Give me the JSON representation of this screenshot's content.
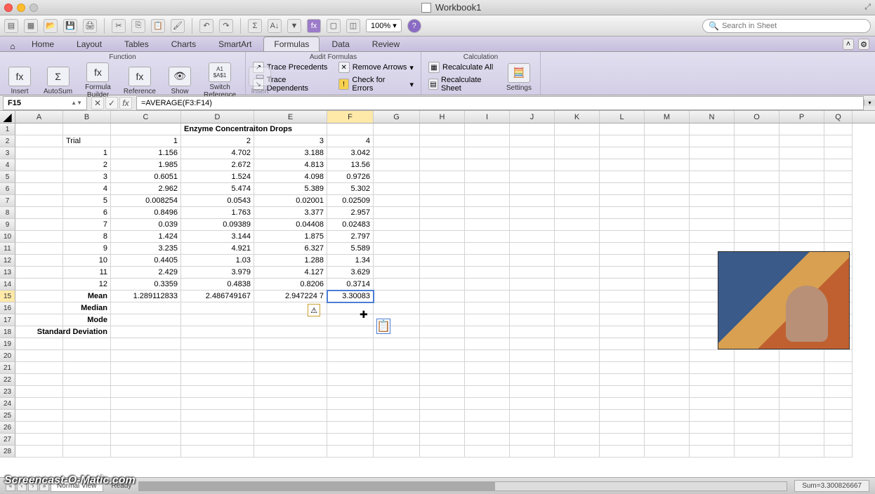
{
  "window": {
    "title": "Workbook1"
  },
  "toolbar": {
    "zoom": "100%"
  },
  "search": {
    "placeholder": "Search in Sheet"
  },
  "tabs": {
    "home": "Home",
    "layout": "Layout",
    "tables": "Tables",
    "charts": "Charts",
    "smartart": "SmartArt",
    "formulas": "Formulas",
    "data": "Data",
    "review": "Review"
  },
  "ribbon": {
    "groups": {
      "function": "Function",
      "audit": "Audit Formulas",
      "calculation": "Calculation"
    },
    "insert": "Insert",
    "autosum": "AutoSum",
    "builder": "Formula\nBuilder",
    "reference": "Reference",
    "show": "Show",
    "switchref_t": "A1",
    "switchref_b": "$A$1",
    "switchref": "Switch\nReference",
    "insert2": "Insert",
    "trace_prec": "Trace Precedents",
    "trace_dep": "Trace Dependents",
    "remove_arrows": "Remove Arrows",
    "check_errors": "Check for Errors",
    "recalc_all": "Recalculate All",
    "recalc_sheet": "Recalculate Sheet",
    "settings": "Settings"
  },
  "formulabar": {
    "cellref": "F15",
    "formula": "=AVERAGE(F3:F14)"
  },
  "columns": [
    "A",
    "B",
    "C",
    "D",
    "E",
    "F",
    "G",
    "H",
    "I",
    "J",
    "K",
    "L",
    "M",
    "N",
    "O",
    "P",
    "Q"
  ],
  "sheet": {
    "title_merged": "Enzyme Concentraiton Drops",
    "trial_label": "Trial",
    "col_headers": [
      "1",
      "2",
      "3",
      "4"
    ],
    "rows": [
      {
        "n": "1",
        "c": "1.156",
        "d": "4.702",
        "e": "3.188",
        "f": "3.042"
      },
      {
        "n": "2",
        "c": "1.985",
        "d": "2.672",
        "e": "4.813",
        "f": "13.56"
      },
      {
        "n": "3",
        "c": "0.6051",
        "d": "1.524",
        "e": "4.098",
        "f": "0.9726"
      },
      {
        "n": "4",
        "c": "2.962",
        "d": "5.474",
        "e": "5.389",
        "f": "5.302"
      },
      {
        "n": "5",
        "c": "0.008254",
        "d": "0.0543",
        "e": "0.02001",
        "f": "0.02509"
      },
      {
        "n": "6",
        "c": "0.8496",
        "d": "1.763",
        "e": "3.377",
        "f": "2.957"
      },
      {
        "n": "7",
        "c": "0.039",
        "d": "0.09389",
        "e": "0.04408",
        "f": "0.02483"
      },
      {
        "n": "8",
        "c": "1.424",
        "d": "3.144",
        "e": "1.875",
        "f": "2.797"
      },
      {
        "n": "9",
        "c": "3.235",
        "d": "4.921",
        "e": "6.327",
        "f": "5.589"
      },
      {
        "n": "10",
        "c": "0.4405",
        "d": "1.03",
        "e": "1.288",
        "f": "1.34"
      },
      {
        "n": "11",
        "c": "2.429",
        "d": "3.979",
        "e": "4.127",
        "f": "3.629"
      },
      {
        "n": "12",
        "c": "0.3359",
        "d": "0.4838",
        "e": "0.8206",
        "f": "0.3714"
      }
    ],
    "stats": {
      "mean": {
        "label": "Mean",
        "c": "1.289112833",
        "d": "2.486749167",
        "e": "2.947224 7",
        "f": "3.30083"
      },
      "median": {
        "label": "Median"
      },
      "mode": {
        "label": "Mode"
      },
      "stddev": {
        "label": "Standard Deviation"
      }
    }
  },
  "status": {
    "view": "Normal View",
    "ready": "Ready",
    "sum": "Sum=3.300826667"
  },
  "watermark": "Screencast-O-Matic.com",
  "chart_data": {
    "type": "table",
    "title": "Enzyme Concentraiton Drops",
    "categories": [
      "1",
      "2",
      "3",
      "4"
    ],
    "series": [
      {
        "name": "Trial 1",
        "values": [
          1.156,
          4.702,
          3.188,
          3.042
        ]
      },
      {
        "name": "Trial 2",
        "values": [
          1.985,
          2.672,
          4.813,
          13.56
        ]
      },
      {
        "name": "Trial 3",
        "values": [
          0.6051,
          1.524,
          4.098,
          0.9726
        ]
      },
      {
        "name": "Trial 4",
        "values": [
          2.962,
          5.474,
          5.389,
          5.302
        ]
      },
      {
        "name": "Trial 5",
        "values": [
          0.008254,
          0.0543,
          0.02001,
          0.02509
        ]
      },
      {
        "name": "Trial 6",
        "values": [
          0.8496,
          1.763,
          3.377,
          2.957
        ]
      },
      {
        "name": "Trial 7",
        "values": [
          0.039,
          0.09389,
          0.04408,
          0.02483
        ]
      },
      {
        "name": "Trial 8",
        "values": [
          1.424,
          3.144,
          1.875,
          2.797
        ]
      },
      {
        "name": "Trial 9",
        "values": [
          3.235,
          4.921,
          6.327,
          5.589
        ]
      },
      {
        "name": "Trial 10",
        "values": [
          0.4405,
          1.03,
          1.288,
          1.34
        ]
      },
      {
        "name": "Trial 11",
        "values": [
          2.429,
          3.979,
          4.127,
          3.629
        ]
      },
      {
        "name": "Trial 12",
        "values": [
          0.3359,
          0.4838,
          0.8206,
          0.3714
        ]
      }
    ],
    "means": [
      1.289112833,
      2.486749167,
      2.9472247,
      3.30083
    ]
  }
}
